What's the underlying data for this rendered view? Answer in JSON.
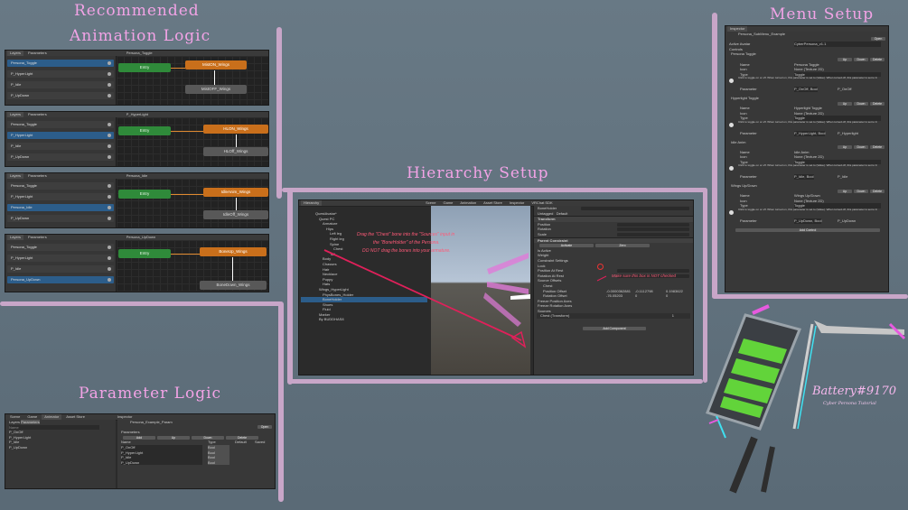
{
  "headings": {
    "recommended_line1": "Recommended",
    "recommended_line2": "Animation Logic",
    "hierarchy": "Hierarchy Setup",
    "menu": "Menu Setup",
    "parameter": "Parameter Logic"
  },
  "signature": {
    "name": "Battery#9170",
    "subtitle": "Cyber Persona Tutorial"
  },
  "animators": [
    {
      "layers_tab": "Layers",
      "params_tab": "Parameters",
      "layer_name": "Persona_Toggle",
      "params": [
        "Persona_Toggle",
        "P_HyperLight",
        "P_Idle",
        "P_UpDown"
      ],
      "selected_index": 0,
      "entry": "Entry",
      "on_state": "MistON_Wings",
      "off_state": "MistOFF_Wings"
    },
    {
      "layers_tab": "Layers",
      "params_tab": "Parameters",
      "layer_name": "P_HyperLight",
      "params": [
        "Persona_Toggle",
        "P_HyperLight",
        "P_Idle",
        "P_UpDown"
      ],
      "selected_index": 1,
      "entry": "Entry",
      "on_state": "HLON_Wings",
      "off_state": "HLOff_Wings"
    },
    {
      "layers_tab": "Layers",
      "params_tab": "Parameters",
      "layer_name": "Persona_Idle",
      "params": [
        "Persona_Toggle",
        "P_HyperLight",
        "Persona_Idle",
        "P_UpDown"
      ],
      "selected_index": 2,
      "entry": "Entry",
      "on_state": "IdleAnim_Wings",
      "off_state": "IdleOff_Wings"
    },
    {
      "layers_tab": "Layers",
      "params_tab": "Parameters",
      "layer_name": "Persona_UpDown",
      "params": [
        "Persona_Toggle",
        "P_HyperLight",
        "P_Idle",
        "Persona_UpDown"
      ],
      "selected_index": 3,
      "entry": "Entry",
      "on_state": "BoneUp_Wings",
      "off_state": "BoneDown_Wings"
    }
  ],
  "hierarchy": {
    "tabs": [
      "Hierarchy",
      "Scene",
      "Game",
      "Animation",
      "Asset Store",
      "Inspector",
      "VRChat SDK"
    ],
    "tree": [
      "QuestAvatar*",
      "Quest PC",
      "Armature",
      "Hips",
      "Left leg",
      "Right leg",
      "Spine",
      "Chest",
      "Tail",
      "Body",
      "Chasses",
      "Hair",
      "Necklace",
      "Puppy",
      "Hats",
      "Wings_HyperLight",
      "PhysBones_Holder",
      "BoneHolder",
      "Shoes",
      "Fluid",
      "Marker",
      "By BUDDHAS8"
    ],
    "note_line1": "Drag the \"Chest\" bone into the \"Sources\" input in",
    "note_line2": "the \"BoneHolder\" of the Persona.",
    "note_line3": "DO NOT drag the bones into your armature.",
    "checkbox_note": "Make sure this box is NOT checked",
    "inspector": {
      "object_name": "BoneHolder",
      "tag": "Untagged",
      "layer": "Default",
      "transform": "Transform",
      "position": "Position",
      "rotation": "Rotation",
      "scale": "Scale",
      "constraint": "Parent Constraint",
      "activate": "Activate",
      "zero": "Zero",
      "is_active": "Is Active",
      "weight": "Weight",
      "constraint_settings": "Constraint Settings",
      "lock": "Lock",
      "position_at_rest": "Position At Rest",
      "rotation_at_rest": "Rotation At Rest",
      "source_offsets": "Source Offsets",
      "chest": "Chest",
      "position_offset": "Position Offset",
      "rotation_offset": "Rotation Offset",
      "pos_offset_values": [
        "-0.0000362881",
        "-0.1112798",
        "0.1983622"
      ],
      "rot_offset_values": [
        "-76.05203",
        "0",
        "0"
      ],
      "freeze_position": "Freeze Position Axes",
      "freeze_rotation": "Freeze Rotation Axes",
      "sources": "Sources",
      "source_item": "Chest (Transform)",
      "source_weight": "1",
      "add_component": "Add Component"
    }
  },
  "parameter_panel": {
    "tabs": [
      "Scene",
      "Game",
      "Animator",
      "Asset Store"
    ],
    "layers_tab": "Layers",
    "params_tab": "Parameters",
    "search_placeholder": "Name",
    "params": [
      "P_OnOff",
      "P_HyperLight",
      "P_Idle",
      "P_UpDown"
    ],
    "inspector_title": "Inspector",
    "asset_name": "Persona_Example_Param",
    "open_label": "Open",
    "section": "Parameters",
    "col_add": "Add",
    "col_up": "Up",
    "col_down": "Down",
    "col_delete": "Delete",
    "col_name": "Name",
    "col_type": "Type",
    "col_default": "Default",
    "col_saved": "Saved",
    "rows": [
      {
        "name": "P_OnOff",
        "type": "Bool"
      },
      {
        "name": "P_HyperLight",
        "type": "Bool"
      },
      {
        "name": "P_Idle",
        "type": "Bool"
      },
      {
        "name": "P_UpDown",
        "type": "Bool"
      }
    ]
  },
  "menu_panel": {
    "title": "Inspector",
    "asset_name": "Persona_SubMenu_Example",
    "open_label": "Open",
    "active_avatar_label": "Active Avatar",
    "active_avatar_value": "CyberPersona_v1.1",
    "controls_label": "Controls",
    "btn_up": "Up",
    "btn_down": "Down",
    "btn_delete": "Delete",
    "name_label": "Name",
    "icon_label": "Icon",
    "icon_value": "None (Texture 2D)",
    "type_label": "Type",
    "type_value": "Toggle",
    "param_label": "Parameter",
    "info_text": "Click to toggle on or off. When turned on, this parameter is set to (Value). When turned off, this parameter is set to 0.",
    "add_control": "Add Control",
    "controls": [
      {
        "title": "Persona Toggle",
        "name": "Persona Toggle",
        "param": "P_OnOff, Bool",
        "param2": "P_OnOff"
      },
      {
        "title": "Hyperlight Toggle",
        "name": "Hyperlight Toggle",
        "param": "P_HyperLight, Bool",
        "param2": "P_Hyperlight"
      },
      {
        "title": "Idle Anim",
        "name": "Idle Anim",
        "param": "P_Idle, Bool",
        "param2": "P_Idle"
      },
      {
        "title": "Wings Up/Down",
        "name": "Wings Up/Down",
        "param": "P_UpDown, Bool",
        "param2": "P_UpDown"
      }
    ]
  },
  "colors": {
    "heading": "#f2a3e6",
    "note_red": "#ff5a78",
    "battery_green": "#62d43a",
    "accent_pink": "#e75adf",
    "accent_cyan": "#3fe0f0"
  }
}
